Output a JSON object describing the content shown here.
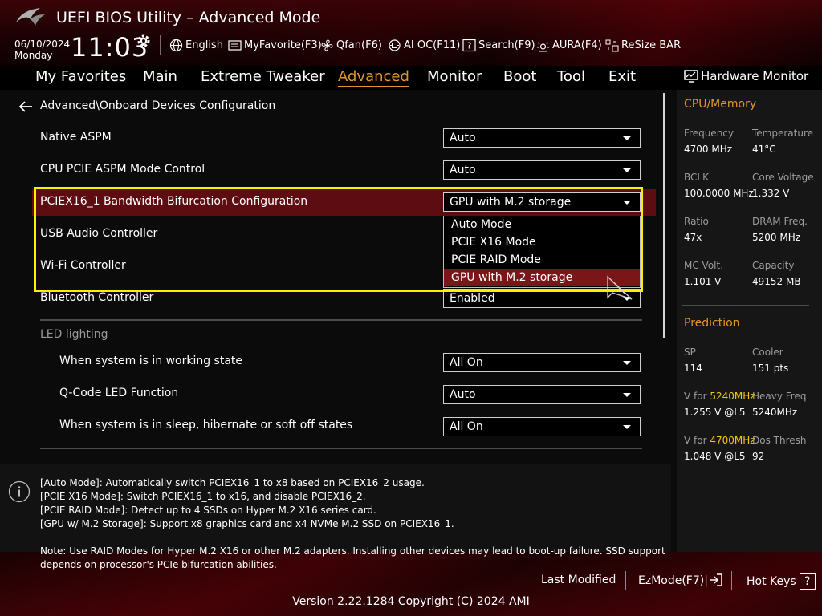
{
  "header": {
    "title": "UEFI BIOS Utility – Advanced Mode",
    "date": "06/10/2024",
    "day": "Monday",
    "time": "11:03"
  },
  "toolbar": {
    "language": "English",
    "myfavorite": "MyFavorite(F3)",
    "qfan": "Qfan(F6)",
    "aioc": "AI OC(F11)",
    "search": "Search(F9)",
    "aura": "AURA(F4)",
    "resizebar": "ReSize BAR"
  },
  "tabs": [
    {
      "label": "My Favorites"
    },
    {
      "label": "Main"
    },
    {
      "label": "Extreme Tweaker"
    },
    {
      "label": "Advanced"
    },
    {
      "label": "Monitor"
    },
    {
      "label": "Boot"
    },
    {
      "label": "Tool"
    },
    {
      "label": "Exit"
    }
  ],
  "breadcrumb": "Advanced\\Onboard Devices Configuration",
  "settings": [
    {
      "label": "Native ASPM",
      "value": "Auto"
    },
    {
      "label": "CPU PCIE ASPM Mode Control",
      "value": "Auto"
    },
    {
      "label": "PCIEX16_1 Bandwidth Bifurcation Configuration",
      "value": "GPU with M.2 storage"
    },
    {
      "label": "USB Audio Controller"
    },
    {
      "label": "Wi-Fi Controller"
    },
    {
      "label": "Bluetooth Controller",
      "value": "Enabled"
    }
  ],
  "dropdown_options": [
    "Auto Mode",
    "PCIE X16 Mode",
    "PCIE RAID Mode",
    "GPU with M.2 storage"
  ],
  "led": {
    "section": "LED lighting",
    "items": [
      {
        "label": "When system is in working state",
        "value": "All On"
      },
      {
        "label": "Q-Code LED Function",
        "value": "Auto"
      },
      {
        "label": "When system is in sleep, hibernate or soft off states",
        "value": "All On"
      }
    ]
  },
  "help": {
    "lines": [
      "[Auto Mode]: Automatically switch PCIEX16_1 to x8 based on PCIEX16_2 usage.",
      "[PCIE X16 Mode]: Switch PCIEX16_1 to x16, and disable PCIEX16_2.",
      "[PCIE RAID Mode]: Detect up to 4 SSDs on Hyper M.2 X16 series card.",
      "[GPU w/ M.2 Storage]: Support x8 graphics card and x4 NVMe M.2 SSD on PCIEX16_1."
    ],
    "note": [
      "Note: Use RAID Modes for Hyper M.2 X16 or other M.2 adapters. Installing other devices may lead to boot-up failure. SSD support",
      "depends on processor's PCIe bifurcation abilities."
    ]
  },
  "hw": {
    "title": "Hardware Monitor",
    "cpu_section": "CPU/Memory",
    "frequency_label": "Frequency",
    "frequency": "4700 MHz",
    "temperature_label": "Temperature",
    "temperature": "41°C",
    "bclk_label": "BCLK",
    "bclk": "100.0000 MHz",
    "core_voltage_label": "Core Voltage",
    "core_voltage": "1.332 V",
    "ratio_label": "Ratio",
    "ratio": "47x",
    "dram_freq_label": "DRAM Freq.",
    "dram_freq": "5200 MHz",
    "mc_volt_label": "MC Volt.",
    "mc_volt": "1.101 V",
    "capacity_label": "Capacity",
    "capacity": "49152 MB",
    "prediction_section": "Prediction",
    "sp_label": "SP",
    "sp": "114",
    "cooler_label": "Cooler",
    "cooler": "151 pts",
    "v_for": "V for",
    "v1_freq": "5240MHz",
    "v1": "1.255 V @L5",
    "heavy_freq_label": "Heavy Freq",
    "heavy_freq": "5240MHz",
    "v2_freq": "4700MHz",
    "v2": "1.048 V @L5",
    "dos_thresh_label": "Dos Thresh",
    "dos_thresh": "92"
  },
  "footer": {
    "last_modified": "Last Modified",
    "ezmode": "EzMode(F7)|",
    "hotkeys": "Hot Keys",
    "hotkeys_key": "?",
    "version": "Version 2.22.1284 Copyright (C) 2024 AMI"
  },
  "colors": {
    "accent": "#e0962a",
    "highlight_row": "#5d0d12",
    "selected_option": "#7a1518",
    "annotation_box": "#ffee00",
    "hw_highlight": "#f4c419"
  }
}
